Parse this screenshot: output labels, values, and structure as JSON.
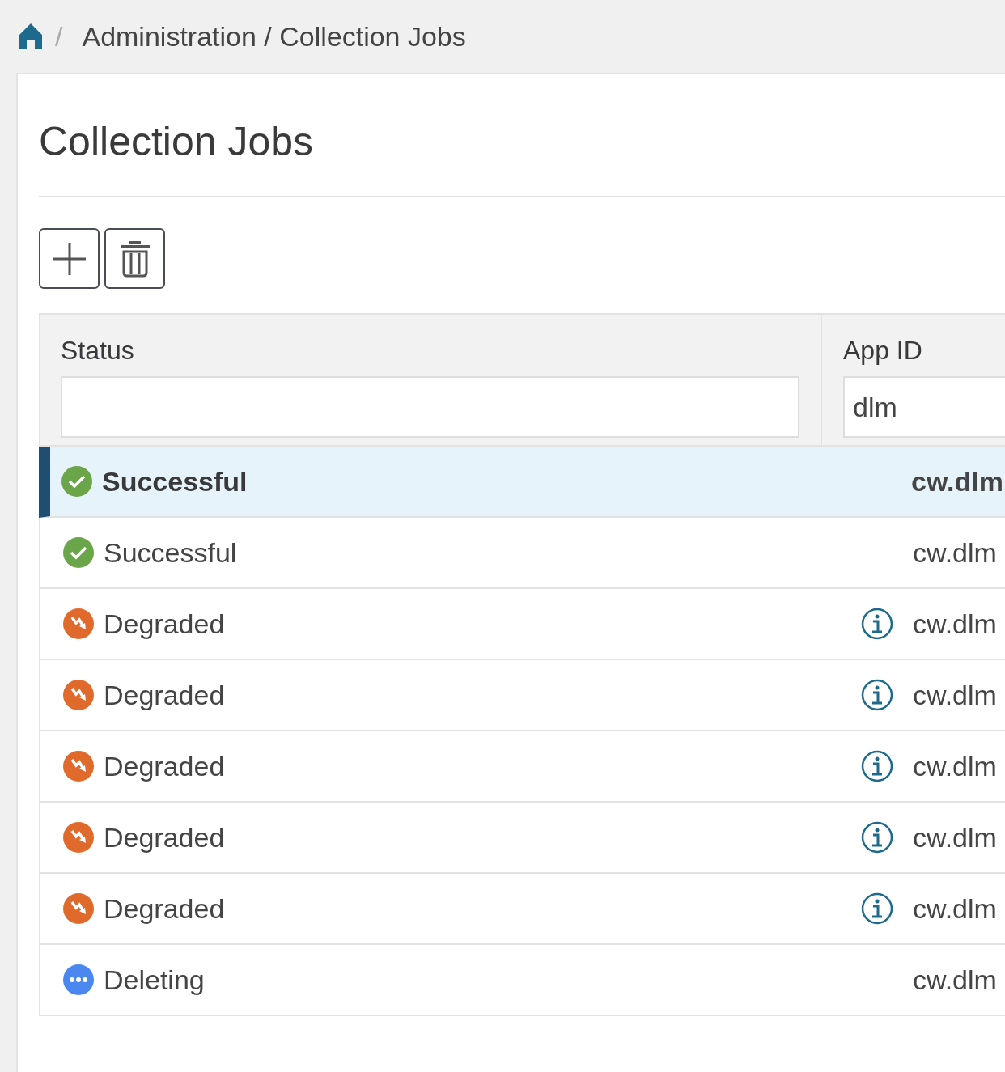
{
  "breadcrumb": {
    "separator": "/",
    "path": "Administration / Collection Jobs"
  },
  "title": "Collection Jobs",
  "table": {
    "columns": [
      {
        "label": "Status"
      },
      {
        "label": "App ID",
        "filter": "dlm"
      }
    ],
    "rows": [
      {
        "kind": "successful",
        "label": "Successful",
        "info": false,
        "app_id": "cw.dlm",
        "selected": true
      },
      {
        "kind": "successful",
        "label": "Successful",
        "info": false,
        "app_id": "cw.dlm",
        "selected": false
      },
      {
        "kind": "degraded",
        "label": "Degraded",
        "info": true,
        "app_id": "cw.dlm",
        "selected": false
      },
      {
        "kind": "degraded",
        "label": "Degraded",
        "info": true,
        "app_id": "cw.dlm",
        "selected": false
      },
      {
        "kind": "degraded",
        "label": "Degraded",
        "info": true,
        "app_id": "cw.dlm",
        "selected": false
      },
      {
        "kind": "degraded",
        "label": "Degraded",
        "info": true,
        "app_id": "cw.dlm",
        "selected": false
      },
      {
        "kind": "degraded",
        "label": "Degraded",
        "info": true,
        "app_id": "cw.dlm",
        "selected": false
      },
      {
        "kind": "deleting",
        "label": "Deleting",
        "info": false,
        "app_id": "cw.dlm",
        "selected": false
      }
    ]
  }
}
